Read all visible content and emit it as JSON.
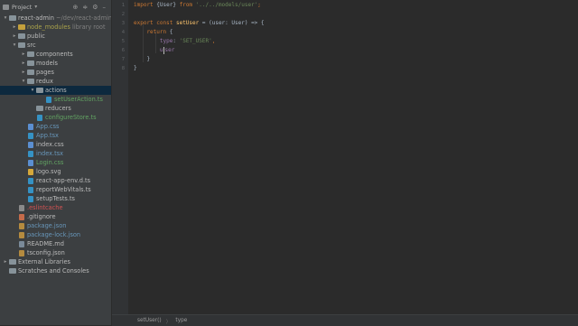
{
  "project_panel": {
    "header_label": "Project",
    "tree": [
      {
        "label": "react-admin",
        "suffix": " ~/dev/react-admin",
        "depth": 0,
        "kind": "root-folder",
        "expanded": true,
        "color": "default"
      },
      {
        "label": "node_modules",
        "suffix": " library root",
        "depth": 1,
        "kind": "folder-excluded",
        "expanded": false,
        "color": "olive"
      },
      {
        "label": "public",
        "depth": 1,
        "kind": "folder",
        "expanded": false,
        "color": "default"
      },
      {
        "label": "src",
        "depth": 1,
        "kind": "folder",
        "expanded": true,
        "color": "default"
      },
      {
        "label": "components",
        "depth": 2,
        "kind": "folder",
        "expanded": false,
        "color": "default"
      },
      {
        "label": "models",
        "depth": 2,
        "kind": "folder",
        "expanded": false,
        "color": "default"
      },
      {
        "label": "pages",
        "depth": 2,
        "kind": "folder",
        "expanded": false,
        "color": "default"
      },
      {
        "label": "redux",
        "depth": 2,
        "kind": "folder",
        "expanded": true,
        "color": "default"
      },
      {
        "label": "actions",
        "depth": 3,
        "kind": "folder",
        "expanded": true,
        "color": "default",
        "selected": true
      },
      {
        "label": "setUserAction.ts",
        "depth": 4,
        "kind": "file",
        "icon": "ts",
        "color": "green"
      },
      {
        "label": "reducers",
        "depth": 3,
        "kind": "folder",
        "expanded": null,
        "color": "default"
      },
      {
        "label": "configureStore.ts",
        "depth": 3,
        "kind": "file",
        "icon": "ts",
        "color": "green"
      },
      {
        "label": "App.css",
        "depth": 2,
        "kind": "file",
        "icon": "css",
        "color": "blue"
      },
      {
        "label": "App.tsx",
        "depth": 2,
        "kind": "file",
        "icon": "tsx",
        "color": "blue"
      },
      {
        "label": "index.css",
        "depth": 2,
        "kind": "file",
        "icon": "css",
        "color": "default"
      },
      {
        "label": "index.tsx",
        "depth": 2,
        "kind": "file",
        "icon": "tsx",
        "color": "blue"
      },
      {
        "label": "Login.css",
        "depth": 2,
        "kind": "file",
        "icon": "css",
        "color": "green"
      },
      {
        "label": "logo.svg",
        "depth": 2,
        "kind": "file",
        "icon": "svg",
        "color": "default"
      },
      {
        "label": "react-app-env.d.ts",
        "depth": 2,
        "kind": "file",
        "icon": "ts",
        "color": "default"
      },
      {
        "label": "reportWebVitals.ts",
        "depth": 2,
        "kind": "file",
        "icon": "ts",
        "color": "default"
      },
      {
        "label": "setupTests.ts",
        "depth": 2,
        "kind": "file",
        "icon": "ts",
        "color": "default"
      },
      {
        "label": ".eslintcache",
        "depth": 1,
        "kind": "file",
        "icon": "cache",
        "color": "red"
      },
      {
        "label": ".gitignore",
        "depth": 1,
        "kind": "file",
        "icon": "git",
        "color": "default"
      },
      {
        "label": "package.json",
        "depth": 1,
        "kind": "file",
        "icon": "json",
        "color": "blue"
      },
      {
        "label": "package-lock.json",
        "depth": 1,
        "kind": "file",
        "icon": "json",
        "color": "blue"
      },
      {
        "label": "README.md",
        "depth": 1,
        "kind": "file",
        "icon": "md",
        "color": "default"
      },
      {
        "label": "tsconfig.json",
        "depth": 1,
        "kind": "file",
        "icon": "json",
        "color": "default"
      },
      {
        "label": "External Libraries",
        "depth": 0,
        "kind": "lib",
        "expanded": false,
        "color": "default"
      },
      {
        "label": "Scratches and Consoles",
        "depth": 0,
        "kind": "scratch",
        "expanded": null,
        "color": "default"
      }
    ]
  },
  "editor": {
    "line_numbers": [
      "1",
      "2",
      "3",
      "4",
      "5",
      "6",
      "7",
      "8"
    ],
    "lines": [
      [
        {
          "t": "import ",
          "c": "kw"
        },
        {
          "t": "{User} ",
          "c": "plain"
        },
        {
          "t": "from ",
          "c": "kw"
        },
        {
          "t": "'../../models/user'",
          "c": "str"
        },
        {
          "t": ";",
          "c": "kw"
        }
      ],
      [],
      [
        {
          "t": "export const ",
          "c": "kw"
        },
        {
          "t": "setUser",
          "c": "fn"
        },
        {
          "t": " = (user: User) => {",
          "c": "plain"
        }
      ],
      [
        {
          "t": "    return ",
          "c": "kw"
        },
        {
          "t": "{",
          "c": "plain"
        }
      ],
      [
        {
          "t": "        type",
          "c": "prop"
        },
        {
          "t": ": ",
          "c": "plain"
        },
        {
          "t": "'SET_USER'",
          "c": "str"
        },
        {
          "t": ",",
          "c": "kw"
        }
      ],
      [
        {
          "t": "        u",
          "c": "prop"
        },
        {
          "t": "CARET",
          "c": "caret"
        },
        {
          "t": "ser",
          "c": "prop"
        }
      ],
      [
        {
          "t": "    }",
          "c": "plain"
        }
      ],
      [
        {
          "t": "}",
          "c": "plain"
        }
      ]
    ]
  },
  "breadcrumb": {
    "items": [
      "setUser()",
      "type"
    ]
  }
}
